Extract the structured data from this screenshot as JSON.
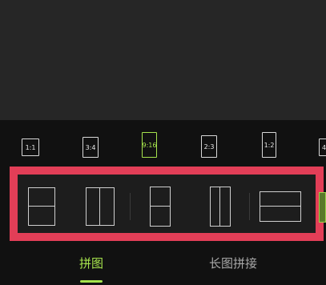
{
  "ratios": [
    {
      "label": "1:1",
      "active": false
    },
    {
      "label": "3:4",
      "active": false
    },
    {
      "label": "9:16",
      "active": true
    },
    {
      "label": "2:3",
      "active": false
    },
    {
      "label": "1:2",
      "active": false
    },
    {
      "label": "4",
      "active": false
    }
  ],
  "layouts": [
    {
      "name": "two-rows-square"
    },
    {
      "name": "two-columns-square"
    },
    {
      "name": "two-rows-tall"
    },
    {
      "name": "two-columns-tall"
    },
    {
      "name": "two-rows-wide"
    }
  ],
  "tabs": {
    "collage": "拼图",
    "long_stitch": "长图拼接"
  },
  "colors": {
    "accent": "#a6e34d",
    "highlight_border": "#e23e57"
  }
}
